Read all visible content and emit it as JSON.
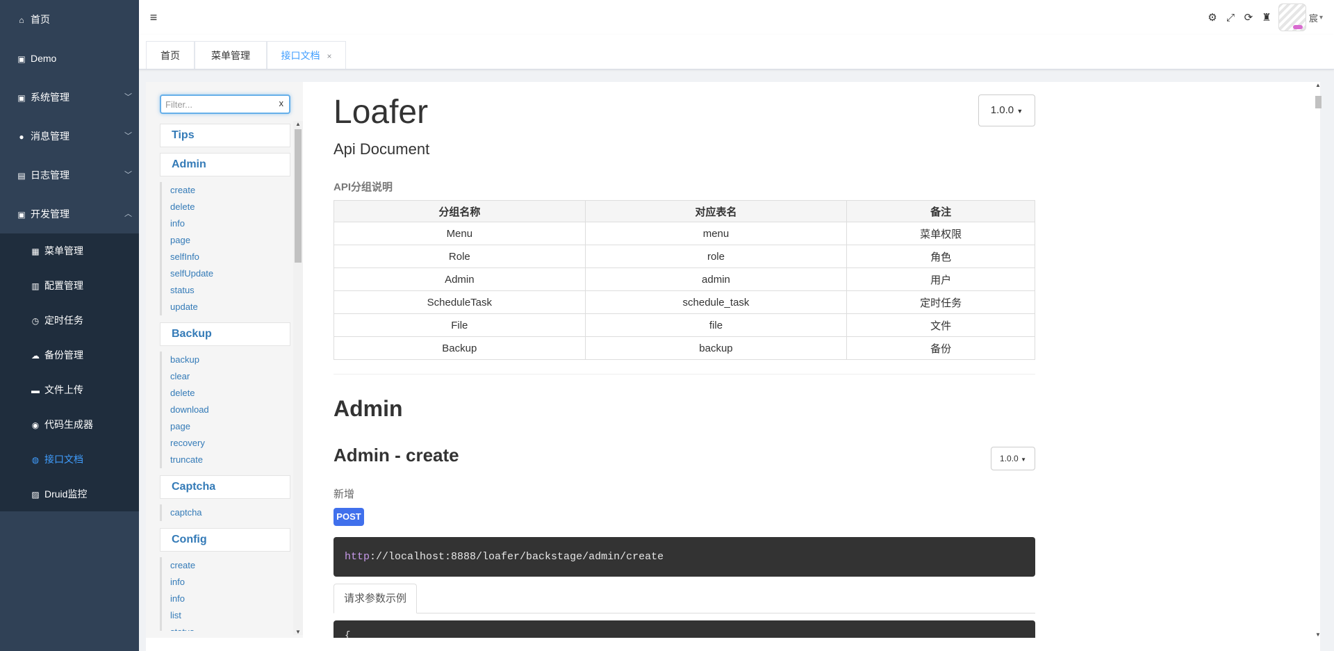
{
  "sidebar": {
    "items": [
      {
        "label": "首页",
        "icon": "home-icon"
      },
      {
        "label": "Demo",
        "icon": "monitor-icon"
      },
      {
        "label": "系统管理",
        "icon": "monitor-icon",
        "expandable": true
      },
      {
        "label": "消息管理",
        "icon": "chat-icon",
        "expandable": true
      },
      {
        "label": "日志管理",
        "icon": "log-icon",
        "expandable": true
      },
      {
        "label": "开发管理",
        "icon": "monitor-icon",
        "expandable": true,
        "expanded": true
      }
    ],
    "dev_subitems": [
      {
        "label": "菜单管理",
        "icon": "grid-icon"
      },
      {
        "label": "配置管理",
        "icon": "list-icon"
      },
      {
        "label": "定时任务",
        "icon": "clock-icon"
      },
      {
        "label": "备份管理",
        "icon": "cloud-upload-icon"
      },
      {
        "label": "文件上传",
        "icon": "folder-icon"
      },
      {
        "label": "代码生成器",
        "icon": "code-icon"
      },
      {
        "label": "接口文档",
        "icon": "globe-icon",
        "active": true
      },
      {
        "label": "Druid监控",
        "icon": "dashboard-icon"
      }
    ],
    "colors": {
      "background": "#304156",
      "submenu_background": "#1f2d3d",
      "active": "#409eff"
    }
  },
  "navbar": {
    "tools": [
      "settings-icon",
      "fullscreen-icon",
      "refresh-icon",
      "broom-icon"
    ],
    "user_name": "宸"
  },
  "tags": [
    {
      "label": "首页"
    },
    {
      "label": "菜单管理"
    },
    {
      "label": "接口文档",
      "active": true,
      "close": "×"
    }
  ],
  "apinav": {
    "filter": {
      "placeholder": "Filter...",
      "value": "",
      "clear_label": "x"
    },
    "groups": [
      {
        "label": "Tips",
        "items": []
      },
      {
        "label": "Admin",
        "items": [
          "create",
          "delete",
          "info",
          "page",
          "selfInfo",
          "selfUpdate",
          "status",
          "update"
        ]
      },
      {
        "label": "Backup",
        "items": [
          "backup",
          "clear",
          "delete",
          "download",
          "page",
          "recovery",
          "truncate"
        ]
      },
      {
        "label": "Captcha",
        "items": [
          "captcha"
        ]
      },
      {
        "label": "Config",
        "items": [
          "create",
          "info",
          "info",
          "list",
          "status"
        ]
      }
    ]
  },
  "doc": {
    "title": "Loafer",
    "subtitle": "Api Document",
    "version": "1.0.0",
    "group_heading": "API分组说明",
    "table": {
      "headers": [
        "分组名称",
        "对应表名",
        "备注"
      ],
      "rows": [
        [
          "Menu",
          "menu",
          "菜单权限"
        ],
        [
          "Role",
          "role",
          "角色"
        ],
        [
          "Admin",
          "admin",
          "用户"
        ],
        [
          "ScheduleTask",
          "schedule_task",
          "定时任务"
        ],
        [
          "File",
          "file",
          "文件"
        ],
        [
          "Backup",
          "backup",
          "备份"
        ]
      ]
    },
    "section": "Admin",
    "api": {
      "title": "Admin - create",
      "version": "1.0.0",
      "description": "新增",
      "method": "POST",
      "url_protocol": "http",
      "url_rest": "://localhost:8888/loafer/backstage/admin/create",
      "tab_label": "请求参数示例",
      "code_first": "{"
    },
    "colors": {
      "link": "#337ab7",
      "method_badge": "#4070ec",
      "code_bg": "#333333",
      "url_protocol": "#c699e8"
    }
  }
}
